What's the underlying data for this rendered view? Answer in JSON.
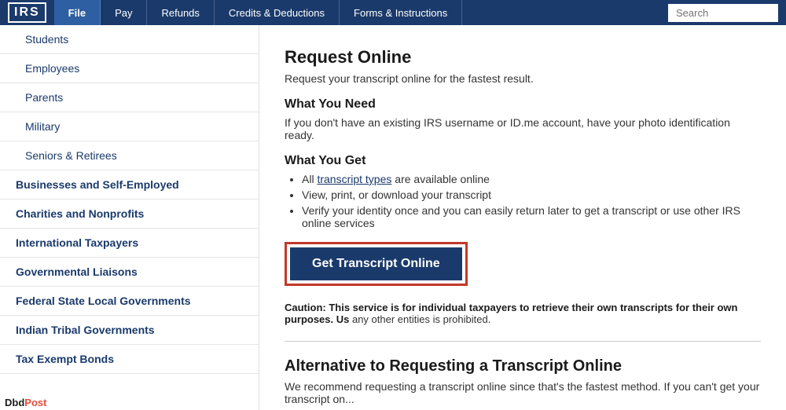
{
  "nav": {
    "logo": "IRS",
    "tabs": [
      {
        "label": "File",
        "active": true
      },
      {
        "label": "Pay",
        "active": false
      },
      {
        "label": "Refunds",
        "active": false
      },
      {
        "label": "Credits & Deductions",
        "active": false
      },
      {
        "label": "Forms & Instructions",
        "active": false
      }
    ],
    "search_placeholder": "Search"
  },
  "sidebar": {
    "items": [
      {
        "label": "Students",
        "type": "sub"
      },
      {
        "label": "Employees",
        "type": "sub"
      },
      {
        "label": "Parents",
        "type": "sub"
      },
      {
        "label": "Military",
        "type": "sub"
      },
      {
        "label": "Seniors & Retirees",
        "type": "sub"
      },
      {
        "label": "Businesses and Self-Employed",
        "type": "section-header"
      },
      {
        "label": "Charities and Nonprofits",
        "type": "section-header"
      },
      {
        "label": "International Taxpayers",
        "type": "section-header"
      },
      {
        "label": "Governmental Liaisons",
        "type": "section-header"
      },
      {
        "label": "Federal State Local Governments",
        "type": "section-header"
      },
      {
        "label": "Indian Tribal Governments",
        "type": "section-header"
      },
      {
        "label": "Tax Exempt Bonds",
        "type": "section-header"
      }
    ]
  },
  "content": {
    "request_online": {
      "title": "Request Online",
      "desc": "Request your transcript online for the fastest result.",
      "what_you_need_title": "What You Need",
      "what_you_need_desc": "If you don't have an existing IRS username or ID.me account, have your photo identification ready.",
      "what_you_get_title": "What You Get",
      "bullets": [
        {
          "text": "All ",
          "link": "transcript types",
          "link_href": "#",
          "rest": " are available online"
        },
        {
          "text": "View, print, or download your transcript",
          "link": "",
          "rest": ""
        },
        {
          "text": "Verify your identity once and you can easily return later to get a transcript or use other IRS online services",
          "link": "",
          "rest": ""
        }
      ],
      "btn_label": "Get Transcript Online",
      "caution": "Caution: This service is for individual taxpayers to retrieve their own transcripts for their own purposes. Us any other entities is prohibited."
    },
    "alternative": {
      "title": "Alternative to Requesting a Transcript Online",
      "desc": "We recommend requesting a transcript online since that's the fastest method. If you can't get your transcript on..."
    }
  },
  "watermark": {
    "brand": "Dbd",
    "brand2": "Post"
  }
}
